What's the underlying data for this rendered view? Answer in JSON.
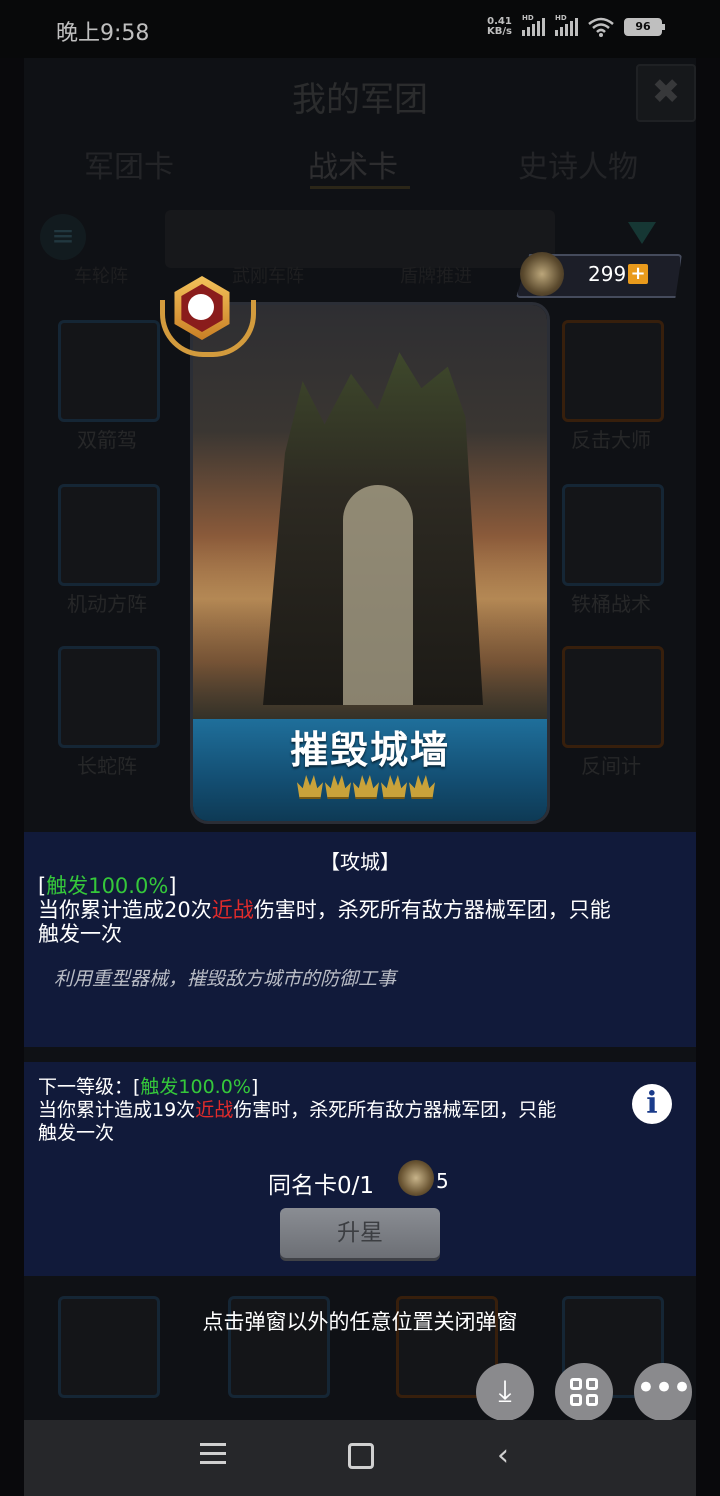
{
  "status_bar": {
    "time": "晚上9:58",
    "net_speed_value": "0.41",
    "net_speed_unit": "KB/s",
    "signal1_label": "HD",
    "signal2_label": "HD",
    "battery": "96"
  },
  "background": {
    "title": "我的军团",
    "close_icon": "✖",
    "tabs": [
      "军团卡",
      "战术卡",
      "史诗人物"
    ],
    "row_labels": [
      "车轮阵",
      "武刚车阵",
      "盾牌推进"
    ],
    "card_labels": [
      "双箭驾",
      "反击大师",
      "机动方阵",
      "铁桶战术",
      "长蛇阵",
      "反间计"
    ]
  },
  "currency": {
    "icon": "legion-emblem-icon",
    "value": "299",
    "plus": "+"
  },
  "card": {
    "name": "摧毁城墙",
    "badge_icon": "bomb-badge-icon",
    "stars": 5,
    "banner_color": "#1f6f9b"
  },
  "description": {
    "category": "【攻城】",
    "trigger_open": "[",
    "trigger": "触发100.0%",
    "trigger_close": "]",
    "effect_part1": "当你累计造成20次",
    "effect_keyword": "近战",
    "effect_part2": "伤害时，杀死所有敌方器械军团，只能",
    "effect_part3": "触发一次",
    "flavor": "利用重型器械，摧毁敌方城市的防御工事"
  },
  "next_level": {
    "label": "下一等级：[",
    "trigger": "触发100.0%",
    "trigger_close": "]",
    "effect_part1": "当你累计造成19次",
    "effect_keyword": "近战",
    "effect_part2": "伤害时，杀死所有敌方器械军团，只能",
    "effect_part3": "触发一次",
    "info_icon": "i"
  },
  "duplicate": {
    "label": "同名卡0/1",
    "cost": "5"
  },
  "upgrade_button": "升星",
  "close_hint": "点击弹窗以外的任意位置关闭弹窗",
  "fabs": {
    "download_icon": "⤓",
    "more_icon": "•••"
  },
  "colors": {
    "panel": "#111a3a",
    "trigger_green": "#35c83a",
    "keyword_red": "#e22b2b"
  }
}
